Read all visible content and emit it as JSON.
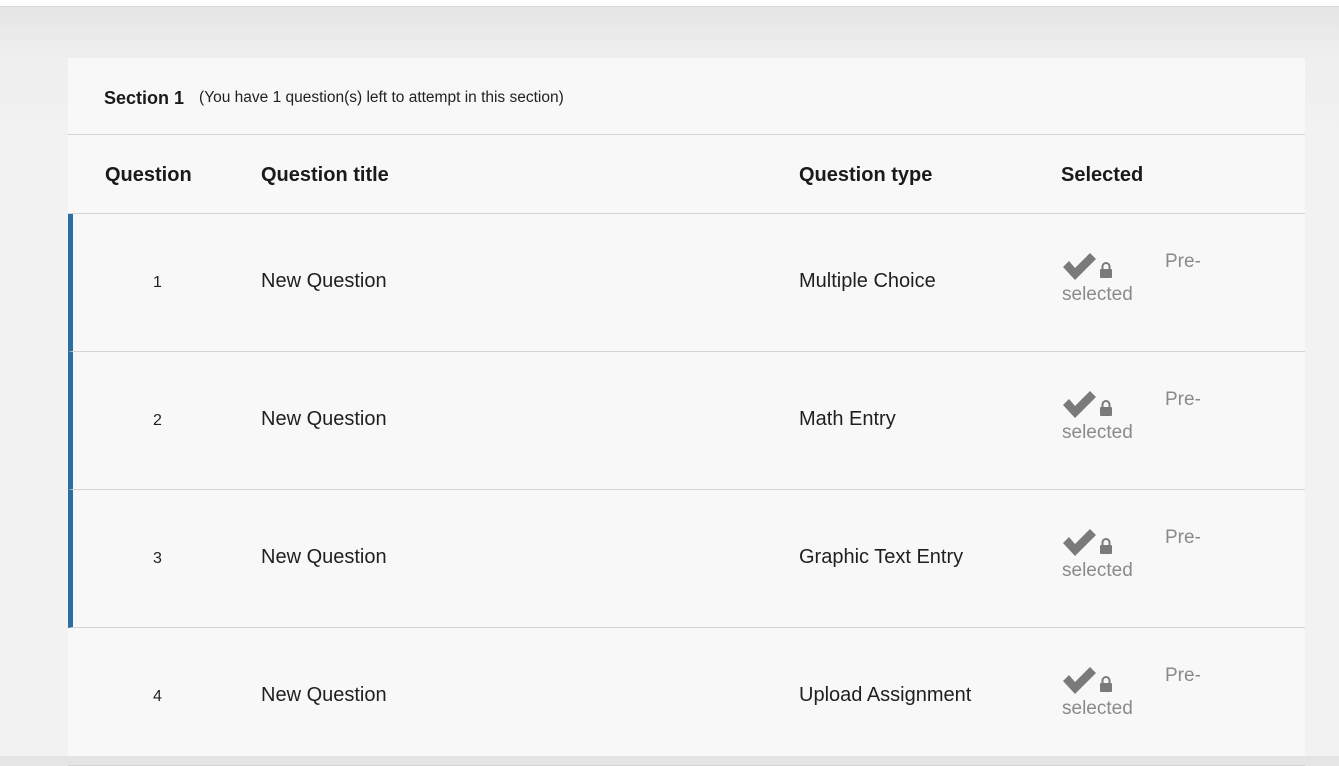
{
  "section": {
    "title": "Section 1",
    "note": "(You have 1 question(s) left to attempt in this section)"
  },
  "table": {
    "headers": {
      "question": "Question",
      "title": "Question title",
      "type": "Question type",
      "selected": "Selected"
    },
    "rows": [
      {
        "number": "1",
        "title": "New Question",
        "type": "Multiple Choice",
        "selected_line1": "Pre-",
        "selected_line2": "selected",
        "marked": true
      },
      {
        "number": "2",
        "title": "New Question",
        "type": "Math Entry",
        "selected_line1": "Pre-",
        "selected_line2": "selected",
        "marked": true
      },
      {
        "number": "3",
        "title": "New Question",
        "type": "Graphic Text Entry",
        "selected_line1": "Pre-",
        "selected_line2": "selected",
        "marked": true
      },
      {
        "number": "4",
        "title": "New Question",
        "type": "Upload Assignment",
        "selected_line1": "Pre-",
        "selected_line2": "selected",
        "marked": false
      }
    ]
  },
  "icons": {
    "selected": "checkmark-icon",
    "locked": "lock-icon"
  },
  "colors": {
    "row_marker": "#2a6ea3",
    "muted_text": "#8a8a8a",
    "icon": "#7a7a7a"
  }
}
